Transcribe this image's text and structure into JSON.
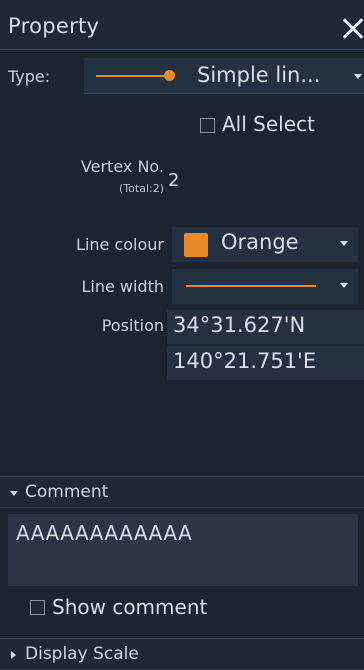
{
  "panel": {
    "title": "Property",
    "close_icon": "close-icon"
  },
  "type": {
    "label": "Type:",
    "value": "Simple lin...",
    "line_color": "#e88a2c"
  },
  "all_select": {
    "label": "All Select",
    "checked": false
  },
  "vertex": {
    "label": "Vertex No.",
    "total": "(Total:2)",
    "value": "2"
  },
  "line_colour": {
    "label": "Line colour",
    "value": "Orange",
    "swatch_color": "#e88a2c"
  },
  "line_width": {
    "label": "Line width"
  },
  "position": {
    "label": "Position",
    "latitude": "34°31.627'N",
    "longitude": "140°21.751'E"
  },
  "comment": {
    "header": "Comment",
    "text": "AAAAAAAAAAAA",
    "expanded": true
  },
  "show_comment": {
    "label": "Show comment",
    "checked": false
  },
  "display_scale": {
    "header": "Display Scale",
    "expanded": false
  },
  "colors": {
    "background": "#1c2430",
    "field": "#253040",
    "accent": "#e88a2c"
  }
}
